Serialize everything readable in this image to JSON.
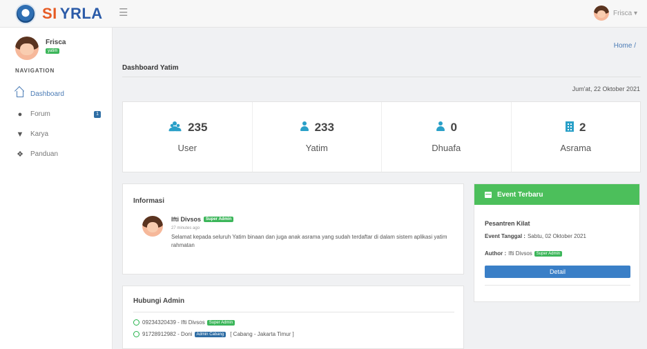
{
  "app": {
    "brand_prefix": "SI",
    "brand_name": "YRLA"
  },
  "topbar": {
    "user_label": "Frisca ▾"
  },
  "sidebar": {
    "profile_name": "Frisca",
    "profile_role": "yatim",
    "nav_heading": "NAVIGATION",
    "items": [
      {
        "label": "Dashboard",
        "icon": "home-icon",
        "active": true
      },
      {
        "label": "Forum",
        "icon": "comments-icon",
        "count": "1"
      },
      {
        "label": "Karya",
        "icon": "trophy-icon"
      },
      {
        "label": "Panduan",
        "icon": "info-icon"
      }
    ]
  },
  "breadcrumb": "Home /",
  "page_title": "Dashboard Yatim",
  "date_text": "Jum'at, 22 Oktober 2021",
  "stats": [
    {
      "icon": "users-icon",
      "value": "235",
      "label": "User"
    },
    {
      "icon": "user-icon",
      "value": "233",
      "label": "Yatim"
    },
    {
      "icon": "user-icon",
      "value": "0",
      "label": "Dhuafa"
    },
    {
      "icon": "building-icon",
      "value": "2",
      "label": "Asrama"
    }
  ],
  "info": {
    "title": "Informasi",
    "author": "Ifti Divsos",
    "author_badge": "Super Admin",
    "time": "27 minutes ago",
    "message": "Selamat kepada seluruh Yatim binaan dan juga anak asrama yang sudah terdaftar di dalam sistem aplikasi yatim rahmatan"
  },
  "admin": {
    "title": "Hubungi Admin",
    "contacts": [
      {
        "text": "09234320439 - Ifti Divsos",
        "badge": "Super Admin"
      },
      {
        "text": "91728912982 - Doni",
        "badge": "Admin Cabang",
        "branch": "[ Cabang - Jakarta Timur ]"
      }
    ]
  },
  "event": {
    "header": "Event Terbaru",
    "name": "Pesantren Kilat",
    "date_label": "Event Tanggal :",
    "date_value": "Sabtu, 02 Oktober 2021",
    "author_label": "Author :",
    "author_value": "Ifti Divsos",
    "author_badge": "Super Admin",
    "button": "Detail"
  },
  "colors": {
    "brand_blue": "#2b5ba8",
    "brand_orange": "#e65b24",
    "accent_green": "#4cbf5b",
    "accent_blue": "#3a7fc7",
    "stat_icon": "#2aa0c8"
  }
}
